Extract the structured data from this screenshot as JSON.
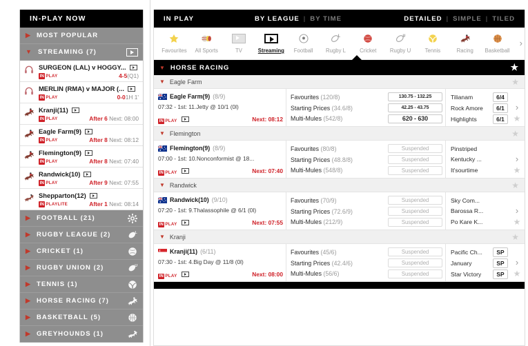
{
  "sidebar": {
    "header": "IN-PLAY NOW",
    "categories_top": [
      {
        "label": "MOST POPULAR",
        "state": "collapsed",
        "icon": "triangle-right-icon"
      },
      {
        "label": "STREAMING (7)",
        "state": "expanded",
        "icon": "triangle-down-icon",
        "right_icon": "tv-icon"
      }
    ],
    "streaming_events": [
      {
        "icon": "headphones-icon",
        "title": "SURGEON (LAL) v HOGGY...",
        "tv": true,
        "play_tag": "PLAY",
        "in_tag": "IN",
        "score": "4-5",
        "score_detail": "(Q1)",
        "type": "match"
      },
      {
        "icon": "headphones-icon",
        "title": "MERLIN (RMA) v MAJOR (...",
        "tv": true,
        "play_tag": "PLAY",
        "in_tag": "IN",
        "score": "0-0",
        "score_detail": "1H 1'",
        "type": "match"
      },
      {
        "icon": "horse-racing-icon",
        "title": "Kranji(11)",
        "tv": true,
        "play_tag": "PLAY",
        "in_tag": "IN",
        "after": "After 6",
        "next": "Next: 08:00",
        "type": "race"
      },
      {
        "icon": "horse-racing-icon",
        "title": "Eagle Farm(9)",
        "tv": true,
        "play_tag": "PLAY",
        "in_tag": "IN",
        "after": "After 8",
        "next": "Next: 08:12",
        "type": "race"
      },
      {
        "icon": "horse-racing-icon",
        "title": "Flemington(9)",
        "tv": true,
        "play_tag": "PLAY",
        "in_tag": "IN",
        "after": "After 8",
        "next": "Next: 07:40",
        "type": "race"
      },
      {
        "icon": "horse-racing-icon",
        "title": "Randwick(10)",
        "tv": true,
        "play_tag": "PLAY",
        "in_tag": "IN",
        "after": "After 9",
        "next": "Next: 07:55",
        "type": "race"
      },
      {
        "icon": "greyhound-icon",
        "title": "Shepparton(12)",
        "tv": true,
        "play_tag": "PLAYLITE",
        "in_tag": "IN",
        "after": "After 1",
        "next": "Next: 08:14",
        "type": "race"
      }
    ],
    "sports": [
      {
        "label": "FOOTBALL (21)",
        "icon": "football-icon"
      },
      {
        "label": "RUGBY LEAGUE (2)",
        "icon": "rugby-league-icon"
      },
      {
        "label": "CRICKET (1)",
        "icon": "cricket-ball-icon"
      },
      {
        "label": "RUGBY UNION (2)",
        "icon": "rugby-union-icon"
      },
      {
        "label": "TENNIS (1)",
        "icon": "tennis-ball-icon"
      },
      {
        "label": "HORSE RACING (7)",
        "icon": "horse-racing-icon"
      },
      {
        "label": "BASKETBALL (5)",
        "icon": "basketball-icon"
      },
      {
        "label": "GREYHOUNDS (1)",
        "icon": "greyhound-icon"
      }
    ]
  },
  "topbar": {
    "title": "IN PLAY",
    "sort_by_league": "BY LEAGUE",
    "sort_by_time": "BY TIME",
    "view_detailed": "DETAILED",
    "view_simple": "SIMPLE",
    "view_tiled": "TILED",
    "separator": "|"
  },
  "sportsbar": {
    "items": [
      {
        "label": "Favourites",
        "icon": "star-icon",
        "active": false
      },
      {
        "label": "All Sports",
        "icon": "all-sports-icon",
        "active": false
      },
      {
        "label": "TV",
        "icon": "tv-icon",
        "active": false
      },
      {
        "label": "Streaming",
        "icon": "play-box-icon",
        "active": true
      },
      {
        "label": "Football",
        "icon": "football-icon",
        "active": false
      },
      {
        "label": "Rugby L",
        "icon": "rugby-league-icon",
        "active": false
      },
      {
        "label": "Cricket",
        "icon": "cricket-ball-icon",
        "active": false
      },
      {
        "label": "Rugby U",
        "icon": "rugby-union-icon",
        "active": false
      },
      {
        "label": "Tennis",
        "icon": "tennis-ball-icon",
        "active": false
      },
      {
        "label": "Racing",
        "icon": "horse-racing-icon",
        "active": false
      },
      {
        "label": "Basketball",
        "icon": "basketball-icon",
        "active": false
      }
    ],
    "next_arrow": "›"
  },
  "section": {
    "title": "HORSE RACING",
    "star": "★"
  },
  "groups": [
    {
      "name": "Eagle Farm",
      "race": {
        "flag": "au-flag-icon",
        "name": "Eagle Farm(9)",
        "count": "(8/9)",
        "detail": "07:32 - 1st: 11.Jetty @ 10/1 (0l)",
        "in_tag": "IN",
        "play_tag": "PLAY",
        "next": "Next: 08:12",
        "markets": [
          {
            "label": "Favourites",
            "count": "(120/8)",
            "odds": "130.75 - 132.25",
            "suspended": false
          },
          {
            "label": "Starting Prices",
            "count": "(34.6/8)",
            "odds": "42.25 - 43.75",
            "suspended": false
          },
          {
            "label": "Multi-Mules",
            "count": "(542/8)",
            "odds": "620 - 630",
            "suspended": false,
            "big": true
          }
        ],
        "selections": [
          {
            "name": "Tilianam",
            "price": "6/4"
          },
          {
            "name": "Rock Amore",
            "price": "6/1"
          },
          {
            "name": "Highlights",
            "price": "6/1"
          }
        ]
      }
    },
    {
      "name": "Flemington",
      "race": {
        "flag": "au-flag-icon",
        "name": "Flemington(9)",
        "count": "(8/9)",
        "detail": "07:00 - 1st: 10.Nonconformist @ 18...",
        "in_tag": "IN",
        "play_tag": "PLAY",
        "next": "Next: 07:40",
        "markets": [
          {
            "label": "Favourites",
            "count": "(80/8)",
            "odds": "Suspended",
            "suspended": true
          },
          {
            "label": "Starting Prices",
            "count": "(48.8/8)",
            "odds": "Suspended",
            "suspended": true
          },
          {
            "label": "Multi-Mules",
            "count": "(548/8)",
            "odds": "Suspended",
            "suspended": true
          }
        ],
        "selections": [
          {
            "name": "Pinstriped",
            "price": ""
          },
          {
            "name": "Kentucky ...",
            "price": ""
          },
          {
            "name": "It'sourtime",
            "price": ""
          }
        ]
      }
    },
    {
      "name": "Randwick",
      "race": {
        "flag": "au-flag-icon",
        "name": "Randwick(10)",
        "count": "(9/10)",
        "detail": "07:20 - 1st: 9.Thalassophile @ 6/1 (0l)",
        "in_tag": "IN",
        "play_tag": "PLAY",
        "next": "Next: 07:55",
        "markets": [
          {
            "label": "Favourites",
            "count": "(70/9)",
            "odds": "Suspended",
            "suspended": true
          },
          {
            "label": "Starting Prices",
            "count": "(72.6/9)",
            "odds": "Suspended",
            "suspended": true
          },
          {
            "label": "Multi-Mules",
            "count": "(212/9)",
            "odds": "Suspended",
            "suspended": true
          }
        ],
        "selections": [
          {
            "name": "Sky Com...",
            "price": ""
          },
          {
            "name": "Barossa R...",
            "price": ""
          },
          {
            "name": "Po Kare K...",
            "price": ""
          }
        ]
      }
    },
    {
      "name": "Kranji",
      "race": {
        "flag": "sg-flag-icon",
        "name": "Kranji(11)",
        "count": "(6/11)",
        "detail": "07:30 - 1st: 4.Big Day @ 11/8 (0l)",
        "in_tag": "IN",
        "play_tag": "PLAY",
        "next": "Next: 08:00",
        "markets": [
          {
            "label": "Favourites",
            "count": "(45/6)",
            "odds": "Suspended",
            "suspended": true
          },
          {
            "label": "Starting Prices",
            "count": "(42.4/6)",
            "odds": "Suspended",
            "suspended": true
          },
          {
            "label": "Multi-Mules",
            "count": "(56/6)",
            "odds": "Suspended",
            "suspended": true
          }
        ],
        "selections": [
          {
            "name": "Pacific Ch...",
            "price": "SP"
          },
          {
            "name": "January",
            "price": "SP"
          },
          {
            "name": "Star Victory",
            "price": "SP"
          }
        ]
      }
    }
  ],
  "colors": {
    "accent_red": "#cf2027",
    "header_black": "#000000",
    "sidebar_grey": "#8e8e8e",
    "group_grey": "#f0f0f0"
  }
}
